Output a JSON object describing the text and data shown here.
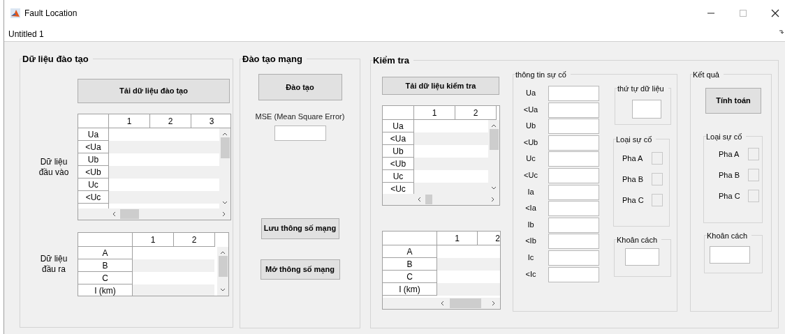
{
  "window": {
    "title": "Fault Location"
  },
  "menu_bar": {
    "items": [
      "Untitled 1"
    ]
  },
  "training_data": {
    "title": "Dữ liệu đào tạo",
    "load_button": "Tải dữ liệu đào tạo",
    "input_label": "Dữ liệu đầu vào",
    "input_table": {
      "columns": [
        "1",
        "2",
        "3"
      ],
      "rows": [
        "Ua",
        "<Ua",
        "Ub",
        "<Ub",
        "Uc",
        "<Uc"
      ]
    },
    "output_label": "Dữ liệu đầu ra",
    "output_table": {
      "columns": [
        "1",
        "2"
      ],
      "rows": [
        "A",
        "B",
        "C",
        "I (km)"
      ]
    }
  },
  "network_training": {
    "title": "Đào tạo mạng",
    "train_button": "Đào tạo",
    "mse_label": "MSE (Mean Square Error)",
    "save_button": "Lưu thông số mạng",
    "open_button": "Mở thông số mạng"
  },
  "test": {
    "title": "Kiểm tra",
    "load_button": "Tải dữ liệu kiểm tra",
    "input_table": {
      "columns": [
        "1",
        "2"
      ],
      "rows": [
        "Ua",
        "<Ua",
        "Ub",
        "<Ub",
        "Uc",
        "<Uc"
      ]
    },
    "output_table": {
      "columns": [
        "1",
        "2"
      ],
      "rows": [
        "A",
        "B",
        "C",
        "I (km)"
      ]
    },
    "fault_info": {
      "title": "thông tin sự cố",
      "fields": [
        "Ua",
        "<Ua",
        "Ub",
        "<Ub",
        "Uc",
        "<Uc",
        "Ia",
        "<Ia",
        "Ib",
        "<Ib",
        "Ic",
        "<Ic"
      ],
      "data_order": {
        "title": "thứ tự dữ liệu"
      },
      "fault_type": {
        "title": "Loại sự cố",
        "phases": [
          {
            "label": "Pha A",
            "checked": false
          },
          {
            "label": "Pha B",
            "checked": false
          },
          {
            "label": "Pha C",
            "checked": false
          }
        ]
      },
      "distance": {
        "title": "Khoân cách"
      }
    },
    "result": {
      "title": "Kết quả",
      "compute_button": "Tính toán",
      "fault_type": {
        "title": "Loại sự cố",
        "phases": [
          {
            "label": "Pha A",
            "checked": false
          },
          {
            "label": "Pha B",
            "checked": false
          },
          {
            "label": "Pha C",
            "checked": false
          }
        ]
      },
      "distance": {
        "title": "Khoân cách"
      }
    }
  }
}
